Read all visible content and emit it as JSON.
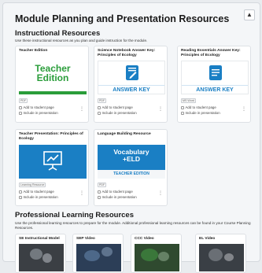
{
  "page_title": "Module Planning and Presentation Resources",
  "collapse_icon": "chevron-up-icon",
  "instructional": {
    "title": "Instructional Resources",
    "description": "Use these instructional resources as you plan and guide instruction for the module.",
    "cards": [
      {
        "title": "Teacher Edition",
        "thumb_text": "Teacher Edition",
        "badge": "PDF",
        "add_label": "Add to student page",
        "include_label": "Include in presentation"
      },
      {
        "title": "Science Notebook Answer Key: Principles of Ecology",
        "thumb_text": "ANSWER KEY",
        "badge": "PDF",
        "add_label": "Add to student page",
        "include_label": "Include in presentation"
      },
      {
        "title": "Reading Essentials Answer Key: Principles of Ecology",
        "thumb_text": "ANSWER KEY",
        "badge": "MS Word",
        "add_label": "Add to student page",
        "include_label": "Include in presentation"
      },
      {
        "title": "Teacher Presentation: Principles of Ecology",
        "badge": "Learning Resource",
        "add_label": "Add to student page",
        "include_label": "Include in presentation"
      },
      {
        "title": "Language Building Resource",
        "thumb_text": "Vocabulary +ELD",
        "thumb_band": "TEACHER EDITION",
        "badge": "PDF",
        "add_label": "Add to student page",
        "include_label": "Include in presentation"
      }
    ]
  },
  "professional": {
    "title": "Professional Learning Resources",
    "description": "Use the professional learning resources to prepare for the module. Additional professional learning resources can be found in your Course Planning Resources.",
    "cards": [
      {
        "title": "SE Instructional Model"
      },
      {
        "title": "SEP Video"
      },
      {
        "title": "CCC Video"
      },
      {
        "title": "EL Video"
      }
    ]
  },
  "colors": {
    "edition_green": "#2a9d3a",
    "resource_blue": "#1a7fc4"
  }
}
